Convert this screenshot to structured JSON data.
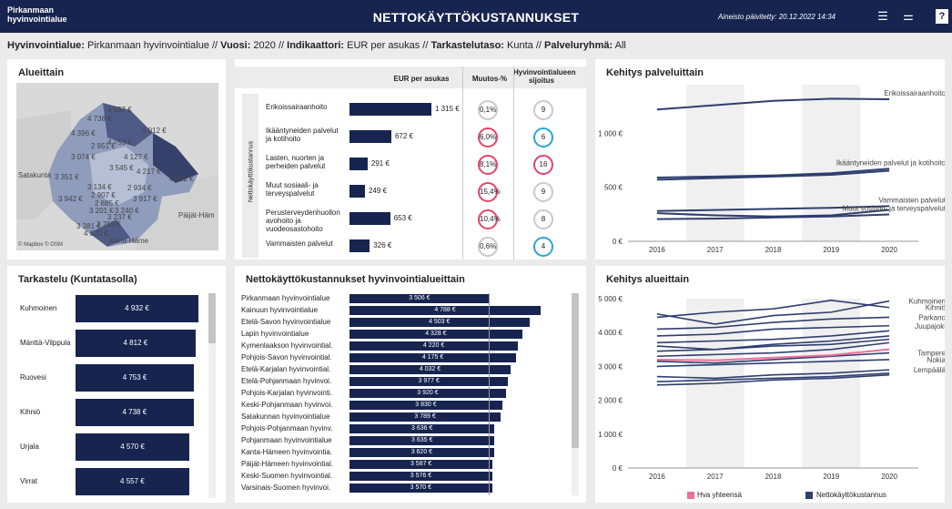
{
  "header": {
    "logo": "Pirkanmaan\nhyvinvointialue",
    "title": "NETTOKÄYTTÖKUSTANNUKSET",
    "updated": "Aineisto päivitetty: 20.12.2022 14:34",
    "menu_icon": "menu-icon",
    "filter_icon": "sliders-icon",
    "help": "?"
  },
  "filters": {
    "k1": "Hyvinvointialue:",
    "v1": " Pirkanmaan hyvinvointialue // ",
    "k2": "Vuosi:",
    "v2": " 2020 // ",
    "k3": "Indikaattori:",
    "v3": " EUR per asukas // ",
    "k4": "Tarkastelutaso:",
    "v4": " Kunta // ",
    "k5": "Palveluryhmä:",
    "v5": " All"
  },
  "map": {
    "title": "Alueittain",
    "attribution": "© Mapbox  © OSM",
    "places": [
      "Satakunta",
      "Päijät-Häm",
      "Karta-Häme"
    ],
    "values": [
      "4 557 €",
      "4 738 €",
      "4 012 €",
      "4 396 €",
      "4 753 €",
      "2 951 €",
      "3 074 €",
      "4 127 €",
      "3 545 €",
      "4 217 €",
      "4 932 €",
      "3 351 €",
      "3 134 €",
      "2 934 €",
      "2 907 €",
      "3 942 €",
      "3 917 €",
      "2 885 €",
      "3 201 €",
      "3 240 €",
      "3 237 €",
      "3 753 €",
      "3 381 €",
      "4 570 €"
    ]
  },
  "table": {
    "headers": [
      "EUR per asukas",
      "Muutos-%",
      "Hyvinvointialueen sijoitus"
    ],
    "group_label": "Nettokäyttökustannus",
    "rows": [
      {
        "name": "Erikoissairaanhoito",
        "value": 1315,
        "label": "1 315 €",
        "change": "0,1%",
        "rank": "9",
        "change_color": "#c9c9c9",
        "rank_color": "#c9c9c9"
      },
      {
        "name": "Ikääntyneiden palvelut ja kotihoito",
        "value": 672,
        "label": "672 €",
        "change": "6,0%",
        "rank": "6",
        "change_color": "#e0456a",
        "rank_color": "#2aa3dc"
      },
      {
        "name": "Lasten, nuorten ja perheiden palvelut",
        "value": 291,
        "label": "291 €",
        "change": "8,1%",
        "rank": "16",
        "change_color": "#e0456a",
        "rank_color": "#e0456a"
      },
      {
        "name": "Muut sosiaali- ja terveyspalvelut",
        "value": 249,
        "label": "249 €",
        "change": "15,4%",
        "rank": "9",
        "change_color": "#e0456a",
        "rank_color": "#c9c9c9"
      },
      {
        "name": "Perusterveydenhuollon avohoito ja vuodeosastohoito",
        "value": 653,
        "label": "653 €",
        "change": "10,4%",
        "rank": "8",
        "change_color": "#e0456a",
        "rank_color": "#c9c9c9"
      },
      {
        "name": "Vammaisten palvelut",
        "value": 326,
        "label": "326 €",
        "change": "0,6%",
        "rank": "4",
        "change_color": "#c9c9c9",
        "rank_color": "#2aa3dc"
      }
    ]
  },
  "kehitys_palvelu": {
    "title": "Kehitys palveluittain"
  },
  "tarkastelu": {
    "title": "Tarkastelu (Kuntatasolla)",
    "rows": [
      {
        "name": "Kuhmoinen",
        "value": 4932,
        "label": "4 932 €"
      },
      {
        "name": "Mänttä-Vilppula",
        "value": 4812,
        "label": "4 812 €"
      },
      {
        "name": "Ruovesi",
        "value": 4753,
        "label": "4 753 €"
      },
      {
        "name": "Kihniö",
        "value": 4738,
        "label": "4 738 €"
      },
      {
        "name": "Urjala",
        "value": 4570,
        "label": "4 570 €"
      },
      {
        "name": "Virrat",
        "value": 4557,
        "label": "4 557 €"
      }
    ]
  },
  "nk": {
    "title": "Nettokäyttökustannukset hyvinvointialueittain"
  },
  "kehitys_alue": {
    "title": "Kehitys alueittain",
    "legend": [
      "Hva yhteensä",
      "Nettokäyttökustannus"
    ],
    "legend_colors": [
      "#ef6f9c",
      "#2f3e6e"
    ]
  },
  "chart_data": [
    {
      "type": "line",
      "title": "Kehitys palveluittain",
      "x": [
        2016,
        2017,
        2018,
        2019,
        2020
      ],
      "yticks": [
        "0 €",
        "500 €",
        "1 000 €"
      ],
      "ylim": [
        0,
        1450
      ],
      "series": [
        {
          "name": "Erikoissairaanhoito",
          "values": [
            1220,
            1260,
            1300,
            1320,
            1315
          ]
        },
        {
          "name": "Ikääntyneiden palvelut ja kotihoito",
          "values": [
            590,
            600,
            610,
            630,
            672
          ]
        },
        {
          "name": "Ikääntyneiden palvelut ja kotihoito",
          "values": [
            570,
            585,
            600,
            615,
            653
          ]
        },
        {
          "name": "Vammaisten palvelut",
          "values": [
            280,
            290,
            300,
            310,
            326
          ]
        },
        {
          "name": "Muut sosiaali- ja terveyspalvelut",
          "values": [
            205,
            210,
            220,
            230,
            249
          ]
        },
        {
          "name": "Muut sosiaali- ja terveyspalvelut",
          "values": [
            260,
            240,
            230,
            240,
            291
          ]
        }
      ]
    },
    {
      "type": "bar",
      "title": "Nettokäyttökustannukset hyvinvointialueittain",
      "categories": [
        "Pirkanmaan hyvinvointialue",
        "Kainuun hyvinvointialue",
        "Etelä-Savon hyvinvointialue",
        "Lapin hyvinvointialue",
        "Kymenlaakson hyvinvointial.",
        "Pohjois-Savon hyvinvointial.",
        "Etelä-Karjalan hyvinvointial.",
        "Etelä-Pohjanmaan hyvinvoi.",
        "Pohjois-Karjalan hyvinvointi.",
        "Keski-Pohjanmaan hyvinvoi.",
        "Satakunnan hyvinvointialue",
        "Pohjois-Pohjanmaan hyvinv.",
        "Pohjanmaan hyvinvointialue",
        "Kanta-Hämeen hyvinvointia.",
        "Päijät-Hämeen hyvinvointial.",
        "Keski-Suomen hyvinvointial.",
        "Varsinais-Suomen hyvinvoi."
      ],
      "values": [
        3506,
        4788,
        4503,
        4328,
        4220,
        4175,
        4032,
        3977,
        3920,
        3830,
        3789,
        3636,
        3635,
        3620,
        3587,
        3576,
        3570
      ],
      "labels": [
        "3 506 €",
        "4 788 €",
        "4 503 €",
        "4 328 €",
        "4 220 €",
        "4 175 €",
        "4 032 €",
        "3 977 €",
        "3 920 €",
        "3 830 €",
        "3 789 €",
        "3 636 €",
        "3 635 €",
        "3 620 €",
        "3 587 €",
        "3 576 €",
        "3 570 €"
      ]
    },
    {
      "type": "line",
      "title": "Kehitys alueittain",
      "x": [
        2016,
        2017,
        2018,
        2019,
        2020
      ],
      "yticks": [
        "0 €",
        "1 000 €",
        "2 000 €",
        "3 000 €",
        "4 000 €",
        "5 000 €"
      ],
      "ylim": [
        0,
        5000
      ],
      "series": [
        {
          "name": "Kuhmoinen",
          "values": [
            4550,
            4250,
            4500,
            4600,
            4932
          ]
        },
        {
          "name": "Kihniö",
          "values": [
            4450,
            4600,
            4700,
            4950,
            4738
          ]
        },
        {
          "name": "Parkano",
          "values": [
            4100,
            4150,
            4300,
            4400,
            4450
          ]
        },
        {
          "name": "Juupajoki",
          "values": [
            3900,
            3950,
            4100,
            4150,
            4200
          ]
        },
        {
          "name": "",
          "values": [
            3700,
            3750,
            3800,
            3900,
            4050
          ]
        },
        {
          "name": "",
          "values": [
            3600,
            3500,
            3650,
            3750,
            3900
          ]
        },
        {
          "name": "",
          "values": [
            3450,
            3500,
            3600,
            3650,
            3800
          ]
        },
        {
          "name": "",
          "values": [
            3300,
            3350,
            3400,
            3500,
            3700
          ]
        },
        {
          "name": "Tampere",
          "values": [
            3150,
            3100,
            3200,
            3300,
            3400
          ]
        },
        {
          "name": "Nokia",
          "values": [
            3000,
            3050,
            3100,
            3150,
            3200
          ]
        },
        {
          "name": "Lempäälä",
          "values": [
            2700,
            2650,
            2750,
            2800,
            2900
          ]
        },
        {
          "name": "",
          "values": [
            2550,
            2600,
            2650,
            2700,
            2800
          ]
        },
        {
          "name": "",
          "values": [
            2450,
            2500,
            2600,
            2650,
            2750
          ]
        }
      ]
    },
    {
      "type": "line",
      "title": "Hva yhteensä",
      "x": [
        2016,
        2017,
        2018,
        2019,
        2020
      ],
      "series": [
        {
          "name": "Hva yhteensä",
          "values": [
            3200,
            3180,
            3260,
            3330,
            3506
          ]
        }
      ]
    }
  ]
}
